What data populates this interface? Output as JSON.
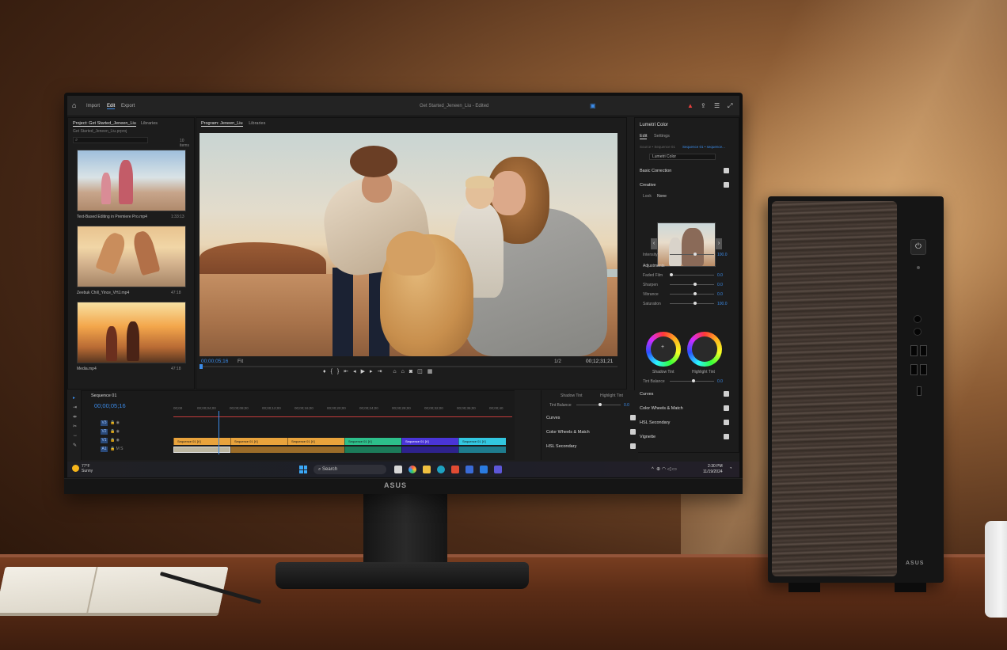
{
  "app": {
    "header": {
      "tabs": [
        {
          "label": "Import"
        },
        {
          "label": "Edit"
        },
        {
          "label": "Export"
        }
      ],
      "title": "Get Started_Jeneen_Liu - Edited"
    },
    "project_panel": {
      "tab": "Project: Get Started_Jeneen_Liu",
      "tab2": "Libraries",
      "subtitle": "Get Started_Jeneen_Liu.prproj",
      "item_count": "10 items",
      "clips": [
        {
          "name": "Text-Based Editing in Premiere Pro.mp4",
          "duration": "1:33:13"
        },
        {
          "name": "Zeebuk Chill_Yince_VHJ.mp4",
          "duration": "47:18"
        },
        {
          "name": "Media.mp4",
          "duration": "47:18"
        }
      ]
    },
    "program_monitor": {
      "tab": "Program: Jeneen_Liu",
      "tab2": "Libraries",
      "timecode_current": "00;00;05;16",
      "fit": "Fit",
      "quality": "1/2",
      "timecode_duration": "00;12;31;21"
    },
    "lumetri": {
      "title": "Lumetri Color",
      "tabs": [
        {
          "label": "Edit"
        },
        {
          "label": "Settings"
        }
      ],
      "source_label": "Source • Sequence 01",
      "sequence_label": "Sequence 01 • sequence...",
      "effect_select": "Lumetri Color",
      "sections": {
        "basic_correction": "Basic Correction",
        "creative": "Creative",
        "look_label": "Look",
        "look_value": "None",
        "intensity_label": "Intensity",
        "intensity_value": "100.0",
        "adjustments": "Adjustments",
        "faded_film_label": "Faded Film",
        "faded_film_value": "0.0",
        "sharpen_label": "Sharpen",
        "sharpen_value": "0.0",
        "vibrance_label": "Vibrance",
        "vibrance_value": "0.0",
        "saturation_label": "Saturation",
        "saturation_value": "100.0",
        "shadow_tint": "Shadow Tint",
        "highlight_tint": "Highlight Tint",
        "tint_balance_label": "Tint Balance",
        "tint_balance_value": "0.0",
        "curves": "Curves",
        "color_wheels": "Color Wheels & Match",
        "hsl_secondary": "HSL Secondary",
        "vignette": "Vignette"
      }
    },
    "timeline": {
      "sequence_tab": "Sequence 01",
      "timecode": "00;00;05;16",
      "ruler": [
        "00;00",
        "00;00;04;00",
        "00;00;08;00",
        "00;00;12;00",
        "00;00;16;00",
        "00;00;20;00",
        "00;00;24;00",
        "00;00;28;00",
        "00;00;32;00",
        "00;00;36;00",
        "00;00;40"
      ],
      "tracks": [
        "V3",
        "V2",
        "V1",
        "A1",
        "A2"
      ],
      "clips": [
        {
          "label": "Sequence 01 [V]",
          "color": "#e9a33c"
        },
        {
          "label": "Sequence 01 [V]",
          "color": "#e9a33c"
        },
        {
          "label": "Sequence 01 [V]",
          "color": "#e9a33c"
        },
        {
          "label": "Sequence 01 [V]",
          "color": "#2dbf8a"
        },
        {
          "label": "Sequence 01 [V]",
          "color": "#4a35d8"
        },
        {
          "label": "Sequence 01 [V]",
          "color": "#32c7e0"
        }
      ]
    },
    "lumetri_lower": {
      "shadow_tint": "Shadow Tint",
      "highlight_tint": "Highlight Tint",
      "tint_balance": "Tint Balance",
      "tint_value": "0.0",
      "curves": "Curves",
      "color_wheels": "Color Wheels & Match",
      "hsl_secondary": "HSL Secondary"
    }
  },
  "taskbar": {
    "weather_temp": "77°F",
    "weather_desc": "Sunny",
    "search": "Search",
    "time": "2:30 PM",
    "date": "11/19/2024"
  },
  "monitor_brand": "ASUS",
  "tower_brand": "ASUS",
  "icons": [
    "home-icon",
    "warning-icon",
    "share-icon",
    "search-icon",
    "play-icon",
    "windows-icon",
    "power-icon"
  ],
  "colors": {
    "accent": "#3b8be8",
    "warning": "#e8403e",
    "timeline_red": "#c43c3c"
  }
}
